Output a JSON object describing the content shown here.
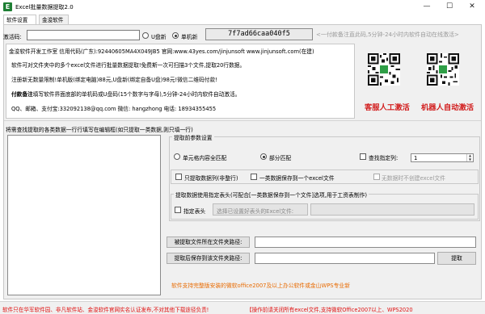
{
  "window": {
    "title": "Excel批量数据提取2.0",
    "app_icon_glyph": "E",
    "minimize_glyph": "—",
    "maximize_glyph": "☐",
    "close_glyph": "✕"
  },
  "tabs": [
    "软件设置",
    "金浚软件"
  ],
  "activation": {
    "code_label": "激活码:",
    "radio_udisk": "U盘新",
    "radio_machine": "单机新",
    "machine_code": "7f7ad66caa040f5",
    "hint": "<一付款备注直此码,5分钟-24小时内软件自动在线激活>"
  },
  "info": {
    "line1": "金浚软件开发工作室 信用代码(广东):92440605MA4X049JB5 官网:www.43yes.com/jinjunsoft  www.jinjunsoft.com(在建)",
    "line2": "软件可对文件夹中的多个excel文件进行批量数据提取!免费斯一次可扫描3个文件,提取20行数据。",
    "line3": "注册新无数量限制!单机版(绑定电脑)88元,U盘新(绑定自备U盘)98元!微信二维码付款!",
    "line4_bold": "付款备注",
    "line4_rest": "填写软件界面底部的单机码或U盘码(15个数字与字母),5分钟-24小时内软件自动激活。",
    "line5": "QQ、邮箱、支付宝:332092138@qq.com    微信: hangzhong    电话: 18934355455"
  },
  "qr": {
    "left_caption": "客服人工激活",
    "right_caption": "机器人自动激活",
    "center_glyph": "S"
  },
  "left": {
    "instruction": "将需查找提取的各类数据一行行填写在编辑框(如只提取一类数据,则只填一行)"
  },
  "extract_settings": {
    "title": "提取前参数设置",
    "radio_full": "单元格内容全匹配",
    "radio_partial": "部分匹配",
    "check_find": "查找指定列:",
    "spin_value": "1",
    "check_whole_row": "只提取数据列(非整行)",
    "check_one_type": "一类数据保存到一个excel文件",
    "check_no_create": "无数据时不创建excel文件",
    "header_section": "提取数据使用指定表头(可配合[一类数据保存到一个文件]选项,用于工资表制作)",
    "check_header": "指定表头",
    "choose_header_btn": "选择已设置好表头的Excel文件:"
  },
  "paths": {
    "source_btn": "被提取文件所在文件夹路径:",
    "save_btn": "提取后保存到该文件夹路径:",
    "extract_btn": "提取"
  },
  "support_note": "软件支持完整版安装的微软office2007及以上办公软件或金山WPS专业新",
  "status": {
    "left": "软件只在华军软件园、非凡软件站、金浚软件官网实名认证发布,不对其他下载途径负责!",
    "right": "【操作前请关闭所有excel文件,支持微软Office2007以上、WPS2020"
  },
  "colors": {
    "accent_red": "#d21e1e",
    "support_orange": "#e86a00",
    "icon_green": "#1e7f34"
  }
}
